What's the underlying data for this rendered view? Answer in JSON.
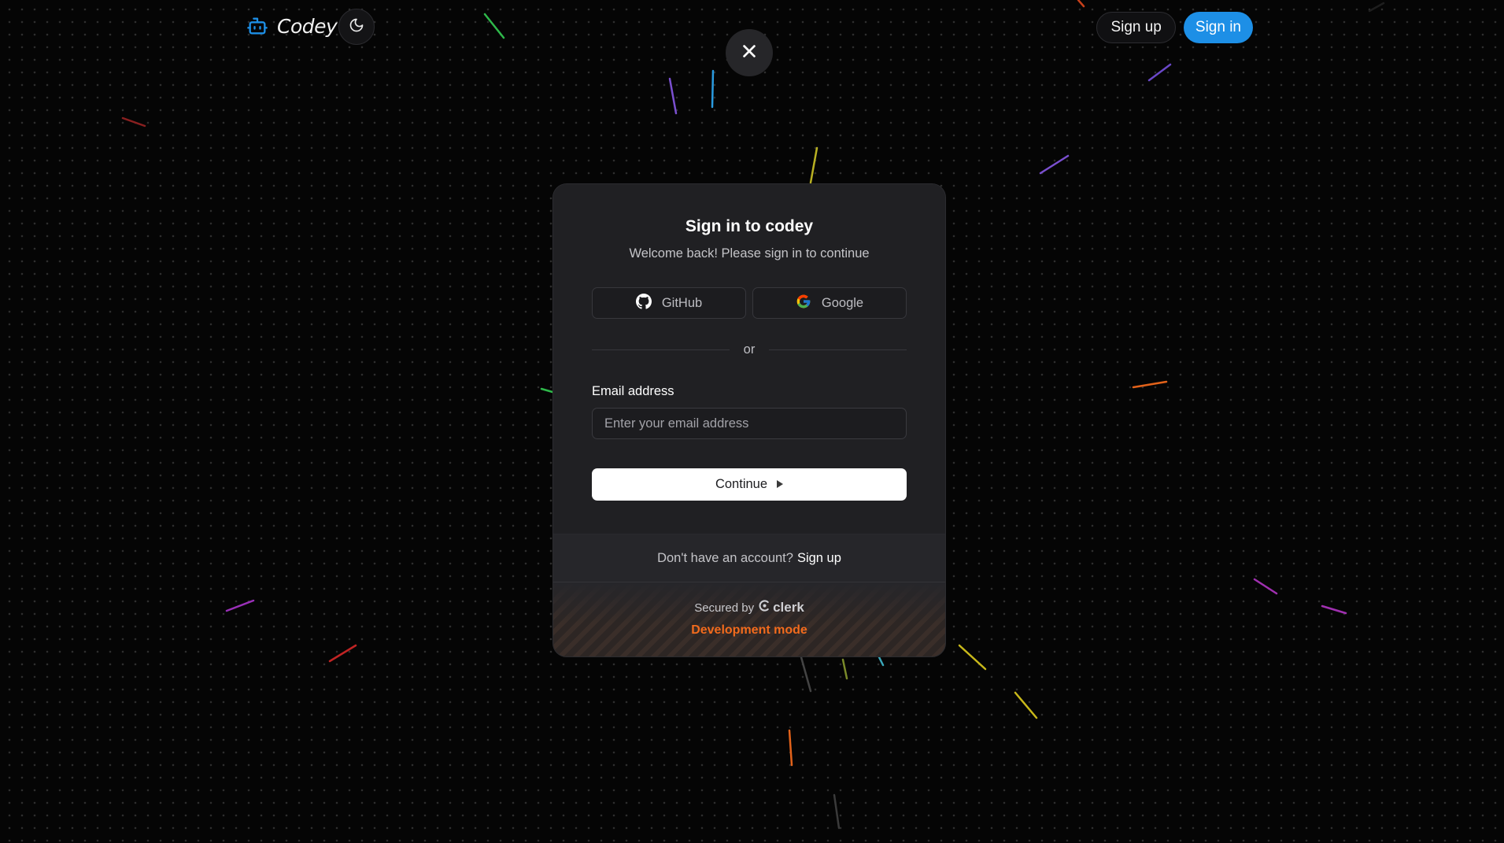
{
  "header": {
    "app_name": "Codey",
    "signup_label": "Sign up",
    "signin_label": "Sign in"
  },
  "modal": {
    "title": "Sign in to codey",
    "subtitle": "Welcome back! Please sign in to continue",
    "social": {
      "github_label": "GitHub",
      "google_label": "Google"
    },
    "divider_text": "or",
    "email": {
      "label": "Email address",
      "placeholder": "Enter your email address",
      "value": ""
    },
    "continue_label": "Continue",
    "footer": {
      "account_prompt": "Don't have an account?",
      "signup_link": "Sign up",
      "secured_by": "Secured by",
      "provider": "clerk",
      "dev_mode": "Development mode"
    }
  },
  "icons": {
    "logo": "robot-icon",
    "theme": "moon-icon",
    "close": "close-icon",
    "github": "github-icon",
    "google": "google-icon",
    "continue": "triangle-right-icon",
    "provider": "clerk-logo-icon"
  },
  "colors": {
    "accent": "#1d8fe6",
    "dev_mode": "#f26b1d",
    "background": "#050505",
    "modal": "#202023"
  }
}
